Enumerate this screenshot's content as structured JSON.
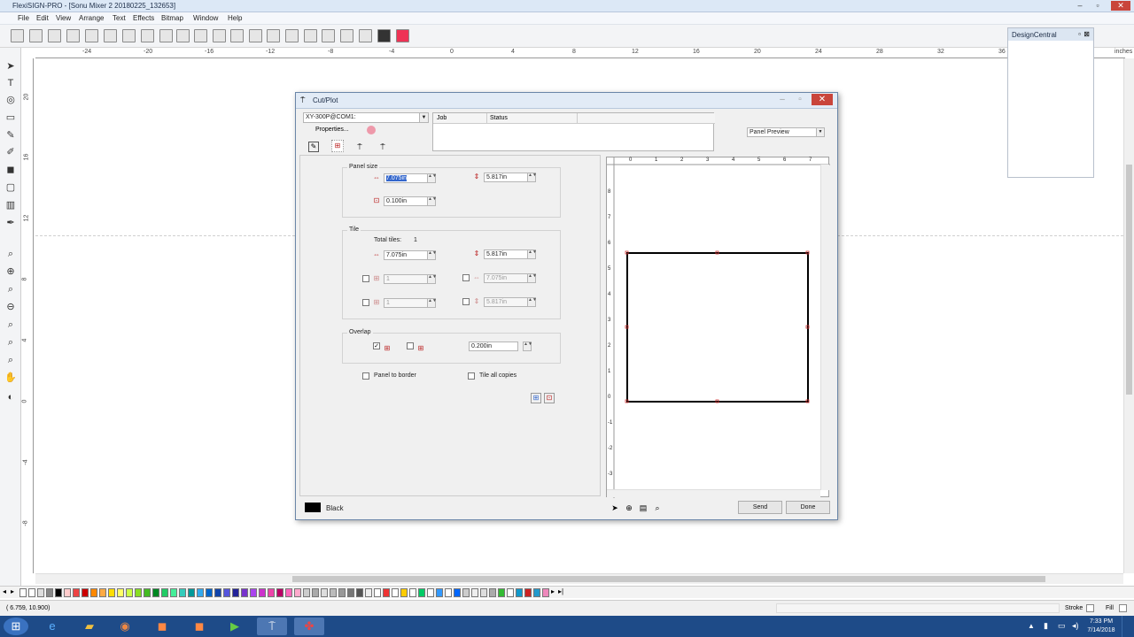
{
  "app": {
    "title": "FlexiSIGN-PRO - [Sonu Mixer 2 20180225_132653]",
    "menu": [
      "File",
      "Edit",
      "View",
      "Arrange",
      "Text",
      "Effects",
      "Bitmap",
      "Window",
      "Help"
    ]
  },
  "ruler": {
    "top_ticks": [
      "-24",
      "-20",
      "-16",
      "-12",
      "-8",
      "-4",
      "0",
      "4",
      "8",
      "12",
      "16",
      "20",
      "24",
      "28",
      "32",
      "36"
    ],
    "units": "inches",
    "left_ticks": [
      "20",
      "16",
      "12",
      "8",
      "4",
      "0",
      "-4",
      "-8"
    ]
  },
  "design_central": {
    "title": "DesignCentral"
  },
  "dialog": {
    "title": "Cut/Plot",
    "device": "XY-300P@COM1:",
    "properties_button": "Properties...",
    "job_columns": [
      "Job",
      "Status"
    ],
    "preview_mode": "Panel Preview",
    "panel_size": {
      "title": "Panel size",
      "width": "7.075in",
      "height": "5.817in",
      "margin": "0.100in"
    },
    "tile": {
      "title": "Tile",
      "total_tiles_label": "Total tiles:",
      "total_tiles_value": "1",
      "width": "7.075in",
      "height": "5.817in",
      "cols": "1",
      "col_width": "7.075in",
      "rows": "1",
      "row_height": "5.817in"
    },
    "overlap": {
      "title": "Overlap",
      "value": "0.200in"
    },
    "panel_to_border": "Panel to border",
    "tile_all_copies": "Tile all copies",
    "color_name": "Black",
    "send_button": "Send",
    "done_button": "Done",
    "preview_ruler_x": [
      "0",
      "1",
      "2",
      "3",
      "4",
      "5",
      "6",
      "7"
    ],
    "preview_ruler_y": [
      "8",
      "7",
      "6",
      "5",
      "4",
      "3",
      "2",
      "1",
      "0",
      "-1",
      "-2",
      "-3"
    ]
  },
  "status": {
    "coords": "( 6.759,  10.900)",
    "stroke_label": "Stroke",
    "fill_label": "Fill"
  },
  "taskbar": {
    "time": "7:33 PM",
    "date": "7/14/2018"
  },
  "colors": {
    "taskbar": "#1e4b88",
    "dialog_bg": "#f0f0f0",
    "accent_red": "#b22222",
    "selection": "#3366cc"
  }
}
